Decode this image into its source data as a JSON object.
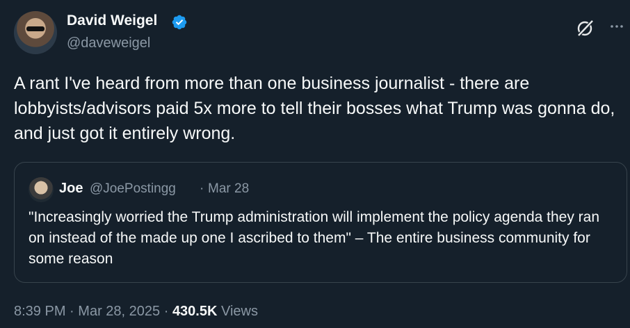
{
  "author": {
    "name": "David Weigel",
    "handle": "@daveweigel",
    "verified": true
  },
  "tweet": {
    "text": "A rant I've heard from more than one business journalist - there are lobbyists/advisors paid 5x more to tell their bosses what Trump was gonna do, and just got it entirely wrong."
  },
  "quoted_tweet": {
    "name": "Joe",
    "handle": "@JoePostingg",
    "separator": "·",
    "date": "Mar 28",
    "text": "\"Increasingly worried the Trump administration will implement the policy agenda they ran on instead of the made up one I ascribed to them\" – The entire business community for some reason"
  },
  "meta": {
    "time": "8:39 PM",
    "separator": "·",
    "date": "Mar 28, 2025",
    "views_count": "430.5K",
    "views_label": "Views"
  },
  "colors": {
    "background": "#15202b",
    "text": "#f7f9f9",
    "secondary": "#8b98a5",
    "verified_badge": "#1d9bf0",
    "border": "#38444d"
  },
  "icons": {
    "verified": "verified-badge-icon",
    "grok": "grok-icon",
    "more": "more-icon"
  }
}
